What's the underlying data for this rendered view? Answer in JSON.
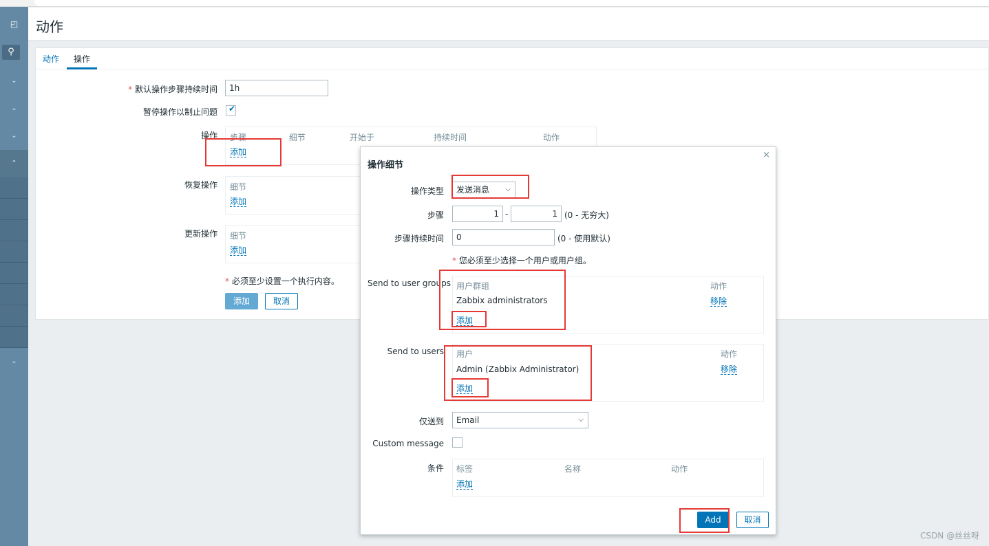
{
  "page": {
    "title": "动作",
    "tabs": [
      {
        "label": "动作"
      },
      {
        "label": "操作"
      }
    ]
  },
  "form": {
    "step_duration_label": "默认操作步骤持续时间",
    "step_duration_value": "1h",
    "pause_label": "暂停操作以制止问题",
    "pause_checked": true,
    "operations_label": "操作",
    "operations_headers": [
      "步骤",
      "细节",
      "开始于",
      "持续时间",
      "动作"
    ],
    "add_link": "添加",
    "recovery_label": "恢复操作",
    "recovery_header": "细节",
    "update_label": "更新操作",
    "update_header": "细节",
    "required_note": "必须至少设置一个执行内容。",
    "add_button": "添加",
    "cancel_button": "取消"
  },
  "dialog": {
    "title": "操作细节",
    "close_glyph": "×",
    "op_type_label": "操作类型",
    "op_type_value": "发送消息",
    "steps_label": "步骤",
    "step_from": "1",
    "step_sep": "-",
    "step_to": "1",
    "steps_hint": "(0 - 无穷大)",
    "step_duration_label": "步骤持续时间",
    "step_duration_value": "0",
    "step_duration_hint": "(0 - 使用默认)",
    "user_required_note": "您必须至少选择一个用户或用户组。",
    "groups_label": "Send to user groups",
    "groups_col_name": "用户群组",
    "groups_col_action": "动作",
    "group_row_name": "Zabbix administrators",
    "remove_link": "移除",
    "add_link": "添加",
    "users_label": "Send to users",
    "users_col_name": "用户",
    "users_col_action": "动作",
    "user_row_name": "Admin (Zabbix Administrator)",
    "send_only_label": "仅送到",
    "send_only_value": "Email",
    "custom_message_label": "Custom message",
    "conditions_label": "条件",
    "conditions_headers": [
      "标签",
      "名称",
      "动作"
    ],
    "add_button": "Add",
    "cancel_button": "取消"
  },
  "watermark": "CSDN @丝丝呀",
  "colors": {
    "accent": "#0275b8",
    "sidebar": "#6389a4",
    "highlight": "#e53935"
  }
}
